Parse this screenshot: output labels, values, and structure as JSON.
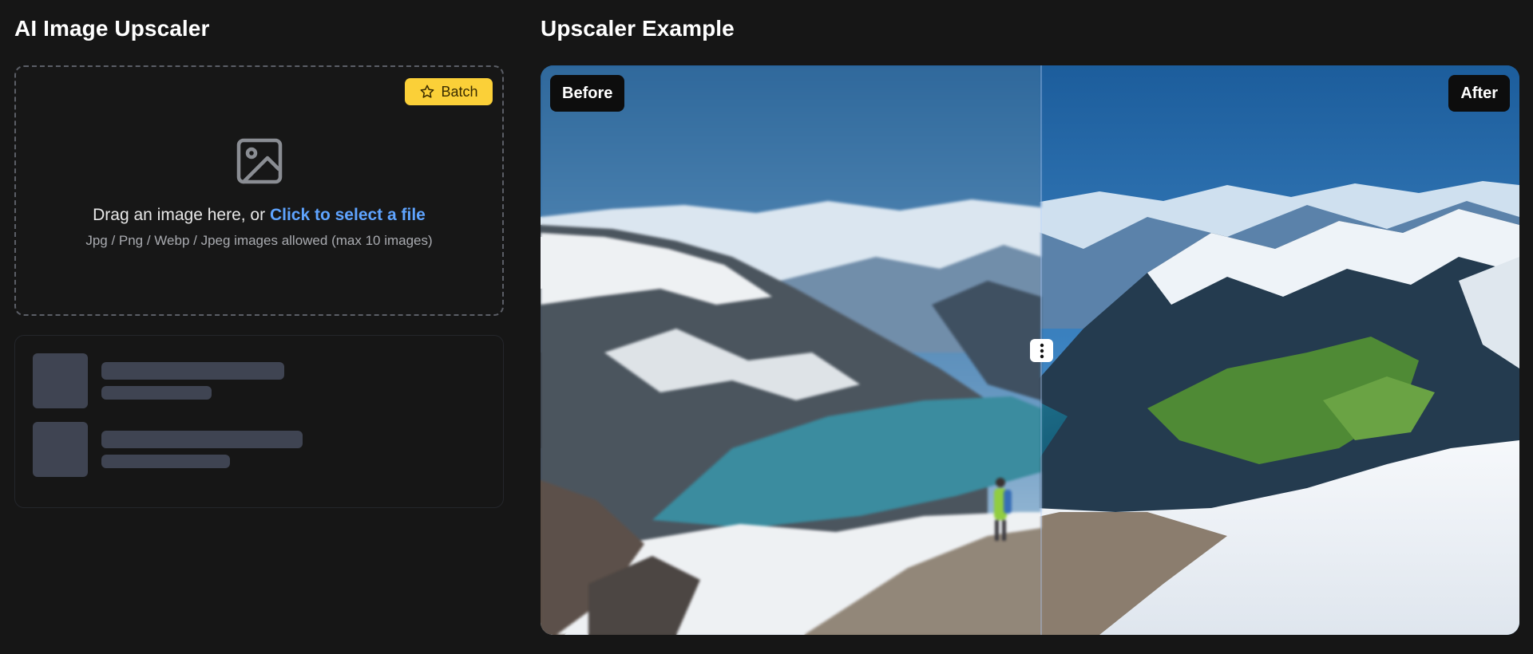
{
  "left_panel": {
    "title": "AI Image Upscaler",
    "batch_button": {
      "label": "Batch",
      "icon": "star-icon",
      "color": "#fbd038"
    },
    "upload_icon": "image-icon",
    "drop_text": "Drag an image here, or ",
    "drop_link": "Click to select a file",
    "hint": "Jpg / Png / Webp / Jpeg images allowed (max 10 images)",
    "link_color": "#5fa4ff"
  },
  "right_panel": {
    "title": "Upscaler Example",
    "before_label": "Before",
    "after_label": "After",
    "handle_icon": "vertical-dots-icon",
    "slider_position": 0.51
  },
  "colors": {
    "background": "#161616",
    "skeleton": "#3f4452"
  }
}
